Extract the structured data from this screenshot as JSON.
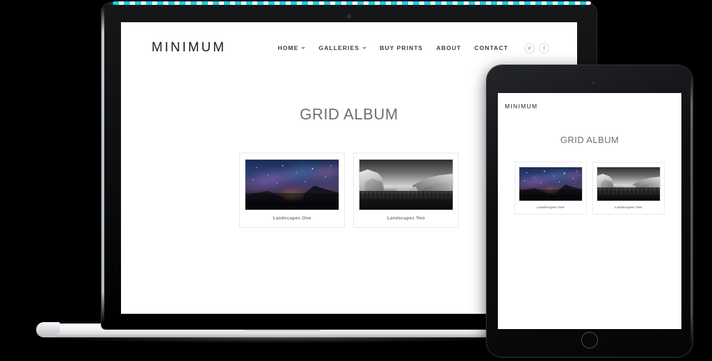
{
  "site": {
    "logo": "MINIMUM",
    "nav": [
      {
        "label": "HOME",
        "has_dropdown": true
      },
      {
        "label": "GALLERIES",
        "has_dropdown": true
      },
      {
        "label": "BUY PRINTS",
        "has_dropdown": false
      },
      {
        "label": "ABOUT",
        "has_dropdown": false
      },
      {
        "label": "CONTACT",
        "has_dropdown": false
      }
    ],
    "social": [
      {
        "name": "twitter-icon",
        "label": "Twitter"
      },
      {
        "name": "facebook-icon",
        "label": "Facebook"
      }
    ],
    "page_title": "GRID ALBUM",
    "albums": [
      {
        "caption": "Landscapes One",
        "photo": "night-sky-over-mountains"
      },
      {
        "caption": "Landscapes Two",
        "photo": "black-and-white-yosemite-valley"
      }
    ]
  },
  "tablet": {
    "logo": "MINIMUM",
    "page_title": "GRID ALBUM",
    "albums": [
      {
        "caption": "Landscapes One"
      },
      {
        "caption": "Landscapes Two"
      }
    ]
  },
  "colors": {
    "background": "#000000",
    "page_background": "#ffffff",
    "title_text": "#6e6e6e",
    "nav_text": "#3d3d3d",
    "logo_text": "#1c1c1c",
    "caption_text": "#7a7a7a",
    "card_border": "#e9e9e9",
    "marker_accent": "#16d0e8"
  }
}
